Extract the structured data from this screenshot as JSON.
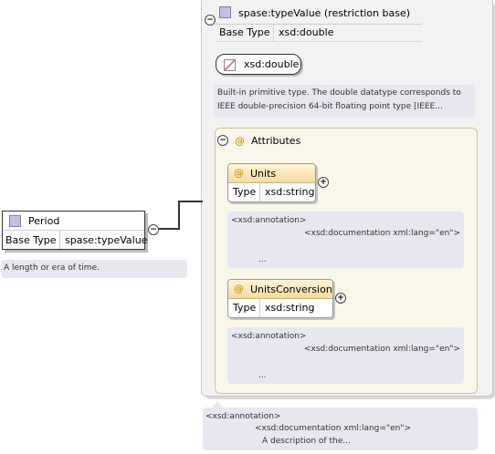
{
  "restriction": {
    "title": "spase:typeValue (restriction base)",
    "base_type_label": "Base Type",
    "base_type_value": "xsd:double"
  },
  "primitive": {
    "label": "xsd:double",
    "description_line1": "Built-in primitive type. The double datatype corresponds to",
    "description_line2": "IEEE double-precision 64-bit floating point type [IEEE..."
  },
  "attributes": {
    "title": "Attributes",
    "items": [
      {
        "name": "Units",
        "type_label": "Type",
        "type_value": "xsd:string",
        "annotation": "<xsd:annotation>",
        "documentation": "<xsd:documentation xml:lang=\"en\">",
        "ellipsis": "..."
      },
      {
        "name": "UnitsConversion",
        "type_label": "Type",
        "type_value": "xsd:string",
        "annotation": "<xsd:annotation>",
        "documentation": "<xsd:documentation xml:lang=\"en\">",
        "ellipsis": "..."
      }
    ]
  },
  "period": {
    "title": "Period",
    "base_type_label": "Base Type",
    "base_type_value": "spase:typeValue",
    "description": "A length or era of time."
  },
  "bottom_annotation": {
    "annotation": "<xsd:annotation>",
    "documentation": "<xsd:documentation xml:lang=\"en\">",
    "text": "A description of the..."
  },
  "icons": {
    "collapse": "−",
    "expand": "+",
    "attribute": "@"
  }
}
